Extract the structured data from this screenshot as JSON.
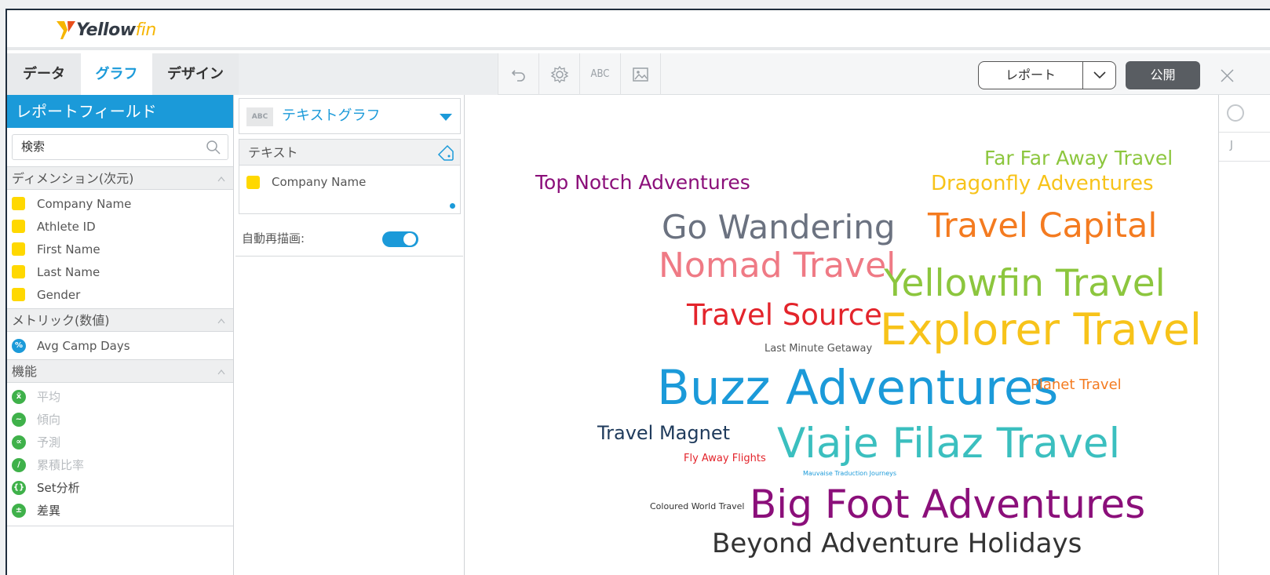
{
  "app": {
    "logo_part1": "Yellow",
    "logo_part2": "fin"
  },
  "tabs": [
    {
      "label": "データ"
    },
    {
      "label": "グラフ"
    },
    {
      "label": "デザイン"
    }
  ],
  "toolbar": {
    "abc_label": "ABC",
    "report_select_value": "レポート",
    "publish_label": "公開"
  },
  "left_panel": {
    "header": "レポートフィールド",
    "search_placeholder": "検索",
    "dimensions_title": "ディメンション(次元)",
    "dimensions": [
      "Company Name",
      "Athlete ID",
      "First Name",
      "Last Name",
      "Gender"
    ],
    "metrics_title": "メトリック(数値)",
    "metrics": [
      {
        "label": "Avg Camp Days",
        "icon": "percent-icon"
      }
    ],
    "functions_title": "機能",
    "functions": [
      {
        "label": "平均",
        "icon": "average-icon",
        "enabled": false
      },
      {
        "label": "傾向",
        "icon": "trend-icon",
        "enabled": false
      },
      {
        "label": "予測",
        "icon": "forecast-icon",
        "enabled": false
      },
      {
        "label": "累積比率",
        "icon": "cumulative-icon",
        "enabled": false
      },
      {
        "label": "Set分析",
        "icon": "set-analysis-icon",
        "enabled": true
      },
      {
        "label": "差異",
        "icon": "variance-icon",
        "enabled": true
      }
    ]
  },
  "mid_panel": {
    "chart_type_badge": "ABC",
    "chart_type": "テキストグラフ",
    "text_section_title": "テキスト",
    "text_field": "Company Name",
    "auto_redraw_label": "自動再描画:",
    "auto_redraw_on": true
  },
  "colors": {
    "accent": "#1b9ad9",
    "dimension_swatch": "#ffd800",
    "function_green": "#3fb14a",
    "publish_bg": "#595d62"
  },
  "chart_data": {
    "type": "wordcloud",
    "field": "Company Name",
    "words": [
      {
        "text": "Far Far Away Travel",
        "color": "#8cc63e"
      },
      {
        "text": "Top Notch Adventures",
        "color": "#8b0f7a"
      },
      {
        "text": "Dragonfly Adventures",
        "color": "#f7c31a"
      },
      {
        "text": "Go Wandering",
        "color": "#6b7280"
      },
      {
        "text": "Travel Capital",
        "color": "#f47b20"
      },
      {
        "text": "Nomad Travel",
        "color": "#ef7a85"
      },
      {
        "text": "Yellowfin Travel",
        "color": "#8cc63e"
      },
      {
        "text": "Travel Source",
        "color": "#e3242b"
      },
      {
        "text": "Explorer Travel",
        "color": "#f7c31a"
      },
      {
        "text": "Last Minute Getaway",
        "color": "#555555"
      },
      {
        "text": "Buzz Adventures",
        "color": "#1b9ad9"
      },
      {
        "text": "Planet Travel",
        "color": "#f47b20"
      },
      {
        "text": "Travel Magnet",
        "color": "#1f3b5c"
      },
      {
        "text": "Viaje Filaz Travel",
        "color": "#3bbfbf"
      },
      {
        "text": "Fly Away Flights",
        "color": "#e3242b"
      },
      {
        "text": "Mauvaise Traduction Journeys",
        "color": "#1b9ad9"
      },
      {
        "text": "Coloured World Travel",
        "color": "#333333"
      },
      {
        "text": "Big Foot Adventures",
        "color": "#8b0f7a"
      },
      {
        "text": "Beyond Adventure Holidays",
        "color": "#333333"
      }
    ]
  }
}
